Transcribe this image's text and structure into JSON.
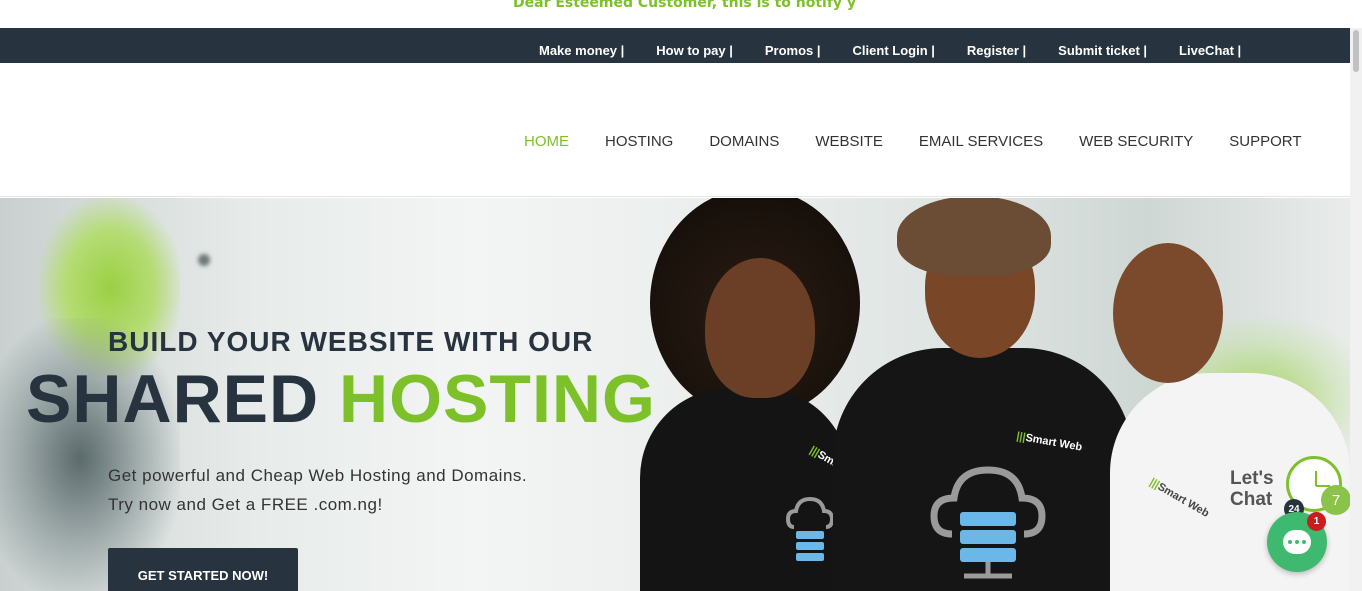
{
  "notice": {
    "text": "Dear Esteemed Customer, this is to notify y"
  },
  "topbar": {
    "links": [
      "Make money |",
      "How to pay |",
      "Promos |",
      "Client Login |",
      "Register |",
      "Submit ticket |",
      "LiveChat |"
    ]
  },
  "mainnav": {
    "items": [
      "HOME",
      "HOSTING",
      "DOMAINS",
      "WEBSITE",
      "EMAIL SERVICES",
      "WEB SECURITY",
      "SUPPORT"
    ],
    "active_index": 0
  },
  "hero": {
    "subtitle": "BUILD YOUR WEBSITE WITH OUR",
    "title_main": "SHARED ",
    "title_accent": "HOSTING",
    "desc_line1": "Get powerful and Cheap Web Hosting and Domains.",
    "desc_line2": "Try now and Get a FREE .com.ng!",
    "cta_label": "GET STARTED NOW!",
    "shirt_logo": "Smart Web"
  },
  "chat_widget": {
    "line1": "Let's",
    "line2": "Chat",
    "badge_hours": "24",
    "badge_days": "7",
    "unread_count": "1"
  },
  "colors": {
    "brand_green": "#7cc12a",
    "navy": "#27343f",
    "chat_green": "#3fb870",
    "badge_red": "#c81e1e"
  }
}
